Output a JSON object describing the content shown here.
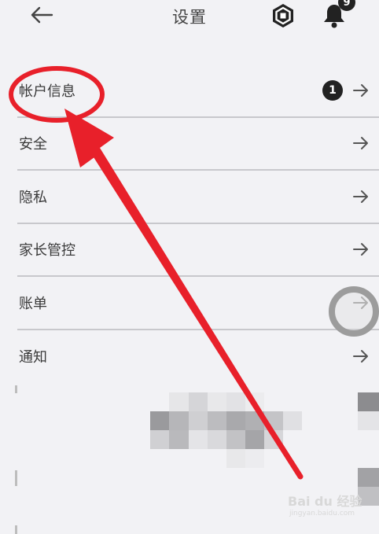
{
  "header": {
    "title": "设置",
    "back_icon": "arrow-left-icon",
    "currency_icon": "robux-icon",
    "notification_icon": "bell-icon",
    "notification_count": "9"
  },
  "settings": {
    "items": [
      {
        "label": "帐户信息",
        "badge": "1"
      },
      {
        "label": "安全"
      },
      {
        "label": "隐私"
      },
      {
        "label": "家长管控"
      },
      {
        "label": "账单"
      },
      {
        "label": "通知"
      }
    ]
  },
  "annotation": {
    "color": "#e8202a"
  },
  "watermark": {
    "text": "Bai du 经验",
    "sub": "jingyan.baidu.com"
  }
}
